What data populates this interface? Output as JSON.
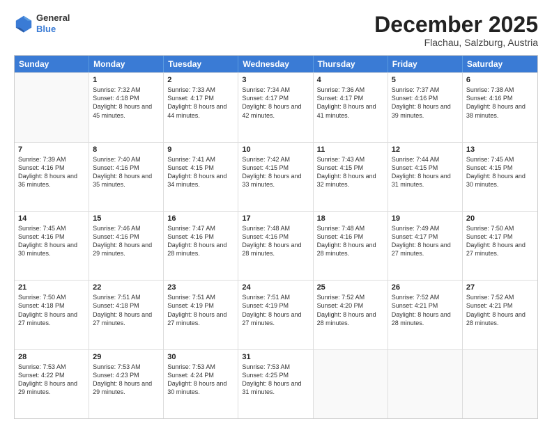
{
  "header": {
    "logo_general": "General",
    "logo_blue": "Blue",
    "month": "December 2025",
    "location": "Flachau, Salzburg, Austria"
  },
  "days_of_week": [
    "Sunday",
    "Monday",
    "Tuesday",
    "Wednesday",
    "Thursday",
    "Friday",
    "Saturday"
  ],
  "weeks": [
    [
      {
        "day": "",
        "empty": true
      },
      {
        "day": "1",
        "sunrise": "7:32 AM",
        "sunset": "4:18 PM",
        "daylight": "8 hours and 45 minutes."
      },
      {
        "day": "2",
        "sunrise": "7:33 AM",
        "sunset": "4:17 PM",
        "daylight": "8 hours and 44 minutes."
      },
      {
        "day": "3",
        "sunrise": "7:34 AM",
        "sunset": "4:17 PM",
        "daylight": "8 hours and 42 minutes."
      },
      {
        "day": "4",
        "sunrise": "7:36 AM",
        "sunset": "4:17 PM",
        "daylight": "8 hours and 41 minutes."
      },
      {
        "day": "5",
        "sunrise": "7:37 AM",
        "sunset": "4:16 PM",
        "daylight": "8 hours and 39 minutes."
      },
      {
        "day": "6",
        "sunrise": "7:38 AM",
        "sunset": "4:16 PM",
        "daylight": "8 hours and 38 minutes."
      }
    ],
    [
      {
        "day": "7",
        "sunrise": "7:39 AM",
        "sunset": "4:16 PM",
        "daylight": "8 hours and 36 minutes."
      },
      {
        "day": "8",
        "sunrise": "7:40 AM",
        "sunset": "4:16 PM",
        "daylight": "8 hours and 35 minutes."
      },
      {
        "day": "9",
        "sunrise": "7:41 AM",
        "sunset": "4:15 PM",
        "daylight": "8 hours and 34 minutes."
      },
      {
        "day": "10",
        "sunrise": "7:42 AM",
        "sunset": "4:15 PM",
        "daylight": "8 hours and 33 minutes."
      },
      {
        "day": "11",
        "sunrise": "7:43 AM",
        "sunset": "4:15 PM",
        "daylight": "8 hours and 32 minutes."
      },
      {
        "day": "12",
        "sunrise": "7:44 AM",
        "sunset": "4:15 PM",
        "daylight": "8 hours and 31 minutes."
      },
      {
        "day": "13",
        "sunrise": "7:45 AM",
        "sunset": "4:15 PM",
        "daylight": "8 hours and 30 minutes."
      }
    ],
    [
      {
        "day": "14",
        "sunrise": "7:45 AM",
        "sunset": "4:16 PM",
        "daylight": "8 hours and 30 minutes."
      },
      {
        "day": "15",
        "sunrise": "7:46 AM",
        "sunset": "4:16 PM",
        "daylight": "8 hours and 29 minutes."
      },
      {
        "day": "16",
        "sunrise": "7:47 AM",
        "sunset": "4:16 PM",
        "daylight": "8 hours and 28 minutes."
      },
      {
        "day": "17",
        "sunrise": "7:48 AM",
        "sunset": "4:16 PM",
        "daylight": "8 hours and 28 minutes."
      },
      {
        "day": "18",
        "sunrise": "7:48 AM",
        "sunset": "4:16 PM",
        "daylight": "8 hours and 28 minutes."
      },
      {
        "day": "19",
        "sunrise": "7:49 AM",
        "sunset": "4:17 PM",
        "daylight": "8 hours and 27 minutes."
      },
      {
        "day": "20",
        "sunrise": "7:50 AM",
        "sunset": "4:17 PM",
        "daylight": "8 hours and 27 minutes."
      }
    ],
    [
      {
        "day": "21",
        "sunrise": "7:50 AM",
        "sunset": "4:18 PM",
        "daylight": "8 hours and 27 minutes."
      },
      {
        "day": "22",
        "sunrise": "7:51 AM",
        "sunset": "4:18 PM",
        "daylight": "8 hours and 27 minutes."
      },
      {
        "day": "23",
        "sunrise": "7:51 AM",
        "sunset": "4:19 PM",
        "daylight": "8 hours and 27 minutes."
      },
      {
        "day": "24",
        "sunrise": "7:51 AM",
        "sunset": "4:19 PM",
        "daylight": "8 hours and 27 minutes."
      },
      {
        "day": "25",
        "sunrise": "7:52 AM",
        "sunset": "4:20 PM",
        "daylight": "8 hours and 28 minutes."
      },
      {
        "day": "26",
        "sunrise": "7:52 AM",
        "sunset": "4:21 PM",
        "daylight": "8 hours and 28 minutes."
      },
      {
        "day": "27",
        "sunrise": "7:52 AM",
        "sunset": "4:21 PM",
        "daylight": "8 hours and 28 minutes."
      }
    ],
    [
      {
        "day": "28",
        "sunrise": "7:53 AM",
        "sunset": "4:22 PM",
        "daylight": "8 hours and 29 minutes."
      },
      {
        "day": "29",
        "sunrise": "7:53 AM",
        "sunset": "4:23 PM",
        "daylight": "8 hours and 29 minutes."
      },
      {
        "day": "30",
        "sunrise": "7:53 AM",
        "sunset": "4:24 PM",
        "daylight": "8 hours and 30 minutes."
      },
      {
        "day": "31",
        "sunrise": "7:53 AM",
        "sunset": "4:25 PM",
        "daylight": "8 hours and 31 minutes."
      },
      {
        "day": "",
        "empty": true
      },
      {
        "day": "",
        "empty": true
      },
      {
        "day": "",
        "empty": true
      }
    ]
  ]
}
